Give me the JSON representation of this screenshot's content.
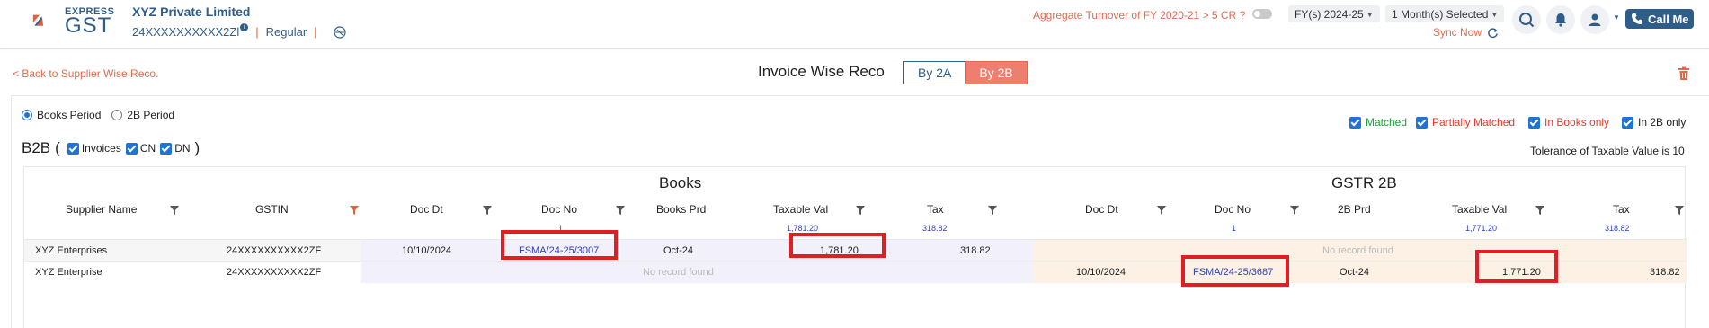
{
  "header": {
    "logo_top": "EXPRESS",
    "logo_bottom": "GST",
    "company_name": "XYZ Private Limited",
    "gstin": "24XXXXXXXXXX2Zl",
    "info_icon": "i",
    "registration_type": "Regular",
    "separator": "|",
    "aggregate_turnover_question": "Aggregate Turnover of FY 2020-21 > 5 CR ?",
    "fy_selected": "FY(s) 2024-25",
    "months_selected": "1 Month(s) Selected",
    "sync_label": "Sync Now",
    "call_label": "Call Me",
    "accent_color": "#2f5d8a",
    "warning_color": "#e06a4f"
  },
  "subbar": {
    "back_label": "< Back to Supplier Wise Reco.",
    "title": "Invoice Wise Reco",
    "tabs": [
      {
        "label": "By 2A",
        "active": false
      },
      {
        "label": "By 2B",
        "active": true
      }
    ]
  },
  "filters": {
    "period_options": [
      {
        "label": "Books Period",
        "selected": true
      },
      {
        "label": "2B Period",
        "selected": false
      }
    ],
    "legend": [
      {
        "label": "Matched",
        "color": "#1f9d3a",
        "checked": true
      },
      {
        "label": "Partially Matched",
        "color": "#e0392b",
        "checked": true
      },
      {
        "label": "In Books only",
        "color": "#e0392b",
        "checked": true
      },
      {
        "label": "In 2B only",
        "color": "#222222",
        "checked": true
      }
    ],
    "section_title": "B2B",
    "open_paren": "(",
    "close_paren": ")",
    "doc_types": [
      {
        "label": "Invoices",
        "checked": true
      },
      {
        "label": "CN",
        "checked": true
      },
      {
        "label": "DN",
        "checked": true
      }
    ],
    "tolerance_text": "Tolerance of Taxable Value is 10"
  },
  "table": {
    "group_books": "Books",
    "group_gstr": "GSTR 2B",
    "columns": {
      "supplier_name": "Supplier Name",
      "gstin": "GSTIN",
      "books_doc_dt": "Doc Dt",
      "books_doc_no": "Doc No",
      "books_prd": "Books Prd",
      "books_taxable": "Taxable Val",
      "books_tax": "Tax",
      "g2b_doc_dt": "Doc Dt",
      "g2b_doc_no": "Doc No",
      "g2b_prd": "2B Prd",
      "g2b_taxable": "Taxable Val",
      "g2b_tax": "Tax"
    },
    "totals": {
      "books_doc_count": "1",
      "books_taxable": "1,781.20",
      "books_tax": "318.82",
      "g2b_doc_count": "1",
      "g2b_taxable": "1,771.20",
      "g2b_tax": "318.82"
    },
    "rows": [
      {
        "supplier_name": "XYZ Enterprises",
        "gstin": "24XXXXXXXXXX2ZF",
        "books_doc_dt": "10/10/2024",
        "books_doc_no": "FSMA/24-25/3007",
        "books_prd": "Oct-24",
        "books_taxable": "1,781.20",
        "books_tax": "318.82",
        "g2b_no_record": "No record found"
      },
      {
        "supplier_name": "XYZ Enterprise",
        "gstin": "24XXXXXXXXXX2ZF",
        "books_no_record": "No record found",
        "g2b_doc_dt": "10/10/2024",
        "g2b_doc_no": "FSMA/24-25/3687",
        "g2b_prd": "Oct-24",
        "g2b_taxable": "1,771.20",
        "g2b_tax": "318.82"
      }
    ]
  }
}
